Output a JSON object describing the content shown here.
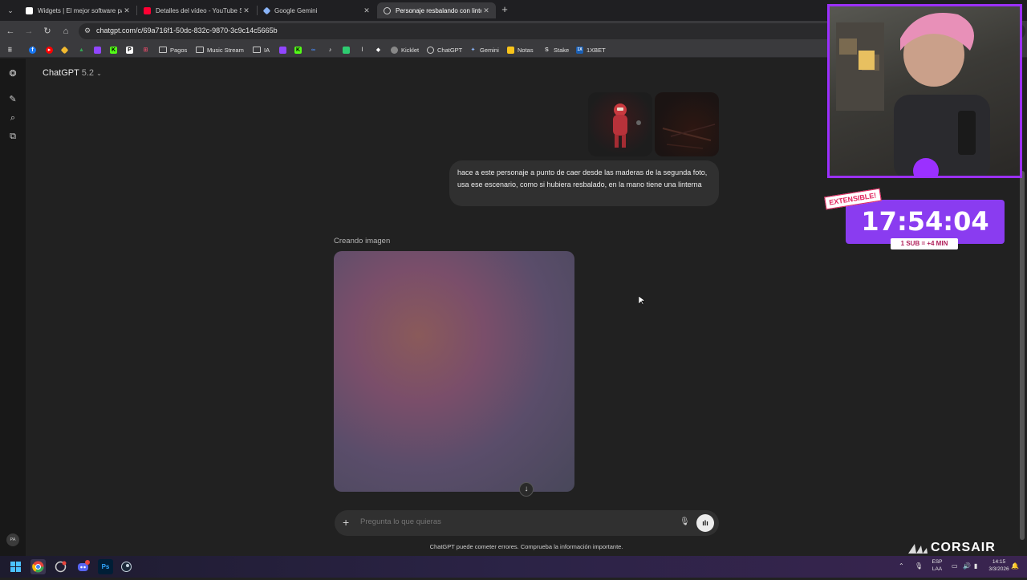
{
  "browser": {
    "tabs": [
      {
        "label": "Widgets | El mejor software par",
        "icon": "widgets-favicon-icon",
        "color": "#ffffff"
      },
      {
        "label": "Detalles del vídeo - YouTube St",
        "icon": "youtube-favicon-icon",
        "color": "#ff0033"
      },
      {
        "label": "Google Gemini",
        "icon": "gemini-favicon-icon",
        "color": "#8ab4f8"
      },
      {
        "label": "Personaje resbalando con lintern",
        "icon": "chatgpt-favicon-icon",
        "color": "#cfcfcf"
      }
    ],
    "new_tab": "+",
    "url": "chatgpt.com/c/69a716f1-50dc-832c-9870-3c9c14c5665b",
    "bookmarks": [
      {
        "label": "",
        "icon": "facebook-icon",
        "color": "#1877f2"
      },
      {
        "label": "",
        "icon": "youtube-icon",
        "color": "#ff0000"
      },
      {
        "label": "",
        "icon": "binance-icon",
        "color": "#f3ba2f"
      },
      {
        "label": "",
        "icon": "drive-icon",
        "color": "#34a853"
      },
      {
        "label": "",
        "icon": "twitch-icon",
        "color": "#9146ff"
      },
      {
        "label": "",
        "icon": "kick-icon",
        "color": "#53fc18"
      },
      {
        "label": "",
        "icon": "patreon-icon",
        "color": "#111111"
      },
      {
        "label": "",
        "icon": "streamlabs-icon",
        "color": "#e94b6a"
      },
      {
        "label": "Pagos",
        "icon": "folder-icon",
        "color": ""
      },
      {
        "label": "Music Stream",
        "icon": "folder-icon",
        "color": ""
      },
      {
        "label": "IA",
        "icon": "folder-icon",
        "color": ""
      },
      {
        "label": "",
        "icon": "twitch-icon",
        "color": "#9146ff"
      },
      {
        "label": "",
        "icon": "kick-icon",
        "color": "#53fc18"
      },
      {
        "label": "",
        "icon": "meta-icon",
        "color": "#0668e1"
      },
      {
        "label": "",
        "icon": "tiktok-icon",
        "color": "#111111"
      },
      {
        "label": "",
        "icon": "app-icon",
        "color": "#2ecc71"
      },
      {
        "label": "",
        "icon": "pin-icon",
        "color": "#cccccc"
      },
      {
        "label": "",
        "icon": "diamond-icon",
        "color": "#ffffff"
      },
      {
        "label": "Kicklet",
        "icon": "kicklet-icon",
        "color": "#888888"
      },
      {
        "label": "ChatGPT",
        "icon": "chatgpt-icon",
        "color": "#cfcfcf"
      },
      {
        "label": "Gemini",
        "icon": "gemini-icon",
        "color": "#8ab4f8"
      },
      {
        "label": "Notas",
        "icon": "notes-icon",
        "color": "#f9c41a"
      },
      {
        "label": "Stake",
        "icon": "stake-icon",
        "color": "#dddddd"
      },
      {
        "label": "1XBET",
        "icon": "xbet-icon",
        "color": "#1a5fb4"
      }
    ]
  },
  "app": {
    "model_name": "ChatGPT",
    "model_version": "5.2",
    "user_message": "hace a este personaje a punto de caer desde las maderas de la segunda foto, usa ese escenario, como si hubiera resbalado, en la mano tiene una linterna",
    "status": "Creando imagen",
    "composer_placeholder": "Pregunta lo que quieras",
    "disclaimer": "ChatGPT puede cometer errores. Comprueba la información importante.",
    "avatar_initials": "PA"
  },
  "overlay": {
    "badge": "EXTENSIBLE!",
    "timer": "17:54:04",
    "sub_rule": "1 SUB = +4 MIN",
    "sponsor": "CORSAIR"
  },
  "taskbar": {
    "apps": [
      {
        "name": "windows-start-icon",
        "color": "#00a4ef",
        "label": ""
      },
      {
        "name": "chrome-icon",
        "color": "#e8453c",
        "label": ""
      },
      {
        "name": "app-icon",
        "color": "#444444",
        "label": ""
      },
      {
        "name": "discord-icon",
        "color": "#5865f2",
        "label": ""
      },
      {
        "name": "photoshop-icon",
        "color": "#001e36",
        "label": "Ps"
      },
      {
        "name": "steam-icon",
        "color": "#1b2838",
        "label": ""
      }
    ],
    "lang_top": "ESP",
    "lang_bottom": "LAA",
    "time": "14:15",
    "date": "3/3/2026"
  }
}
